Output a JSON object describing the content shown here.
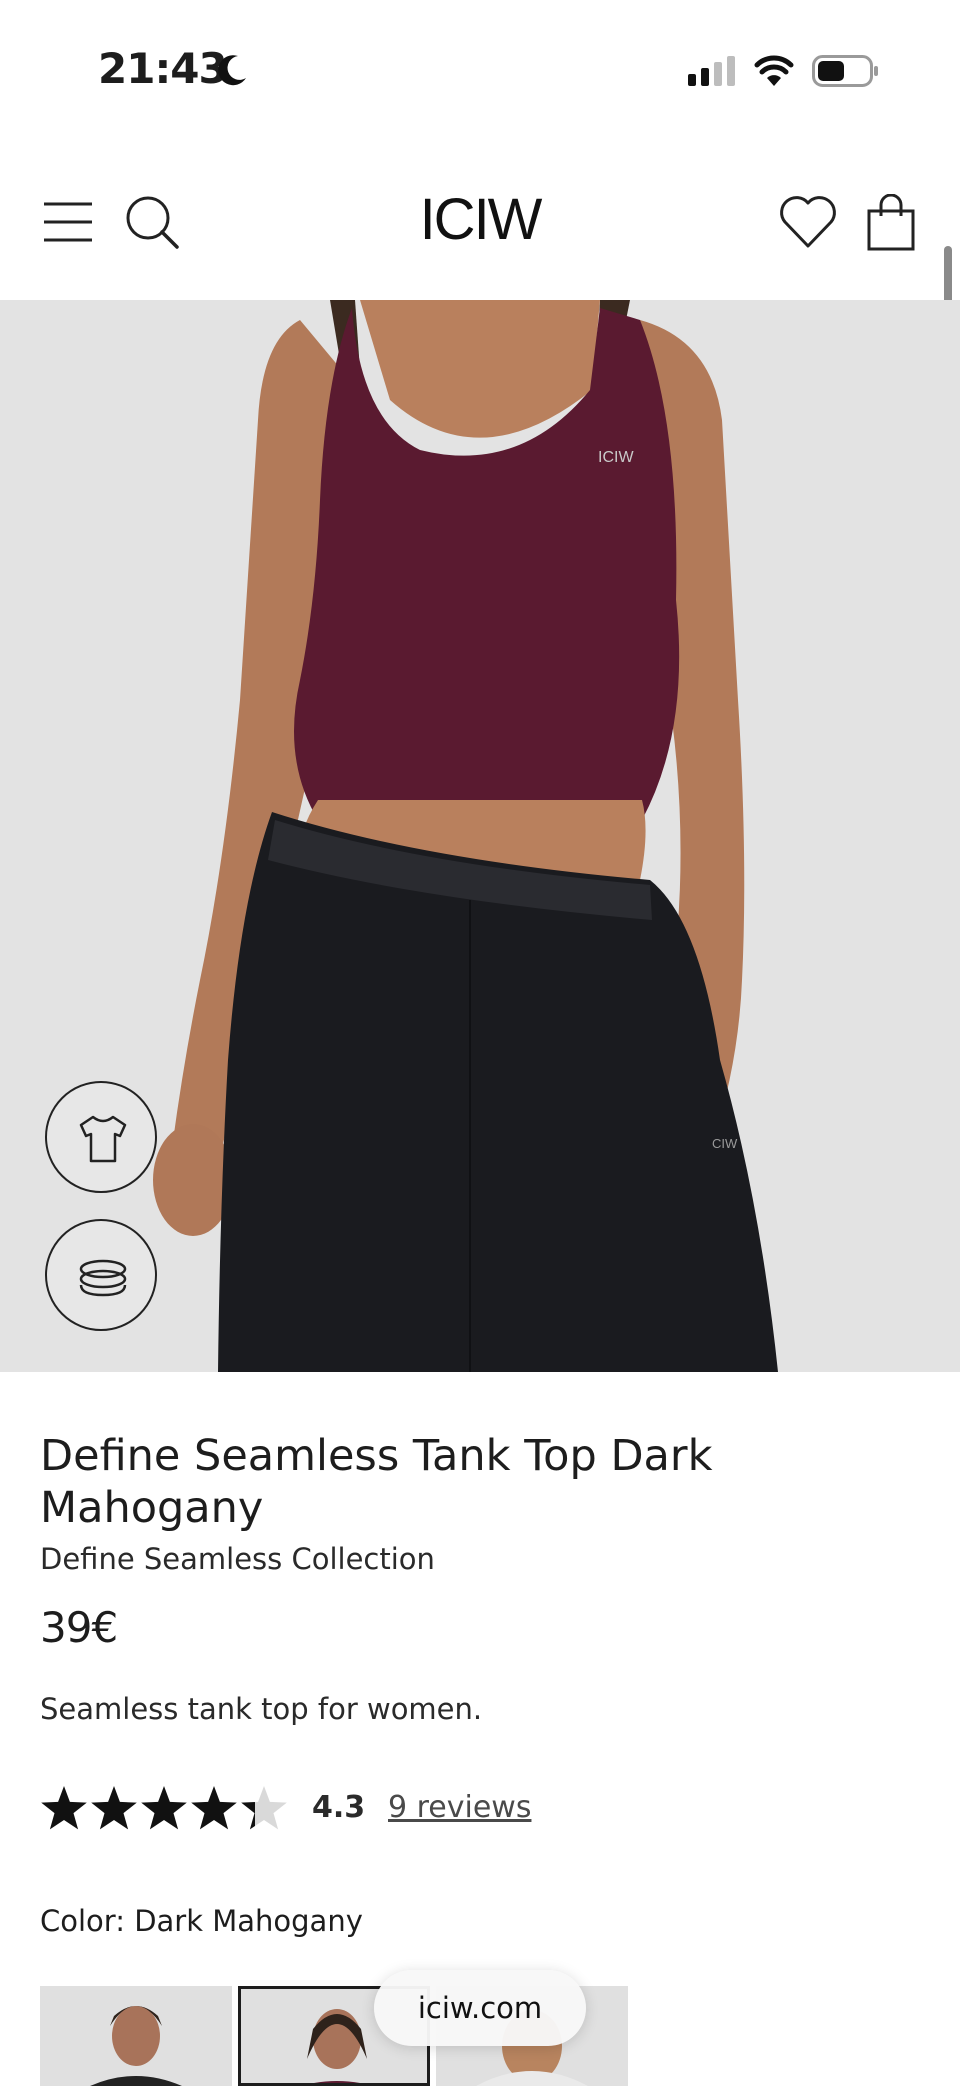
{
  "status_bar": {
    "time": "21:43",
    "icons": [
      "moon-icon",
      "signal-icon",
      "wifi-icon",
      "battery-icon"
    ]
  },
  "header": {
    "logo": "ICIW",
    "icons": [
      "menu-icon",
      "search-icon",
      "heart-icon",
      "bag-icon"
    ]
  },
  "hero": {
    "icons": [
      "tshirt-icon",
      "rotate-360-icon"
    ],
    "colors": {
      "background": "#e3e3e3",
      "top": "#5a1a30",
      "pants": "#1a1b1f"
    }
  },
  "product": {
    "title": "Define Seamless Tank Top Dark Mahogany",
    "collection": "Define Seamless Collection",
    "price": "39€",
    "description": "Seamless tank top for women.",
    "rating_value": "4.3",
    "rating_stars": 4.3,
    "rating_max": 5,
    "reviews_label": "9 reviews",
    "color_label": "Color: Dark Mahogany"
  },
  "browser": {
    "url": "iciw.com"
  }
}
